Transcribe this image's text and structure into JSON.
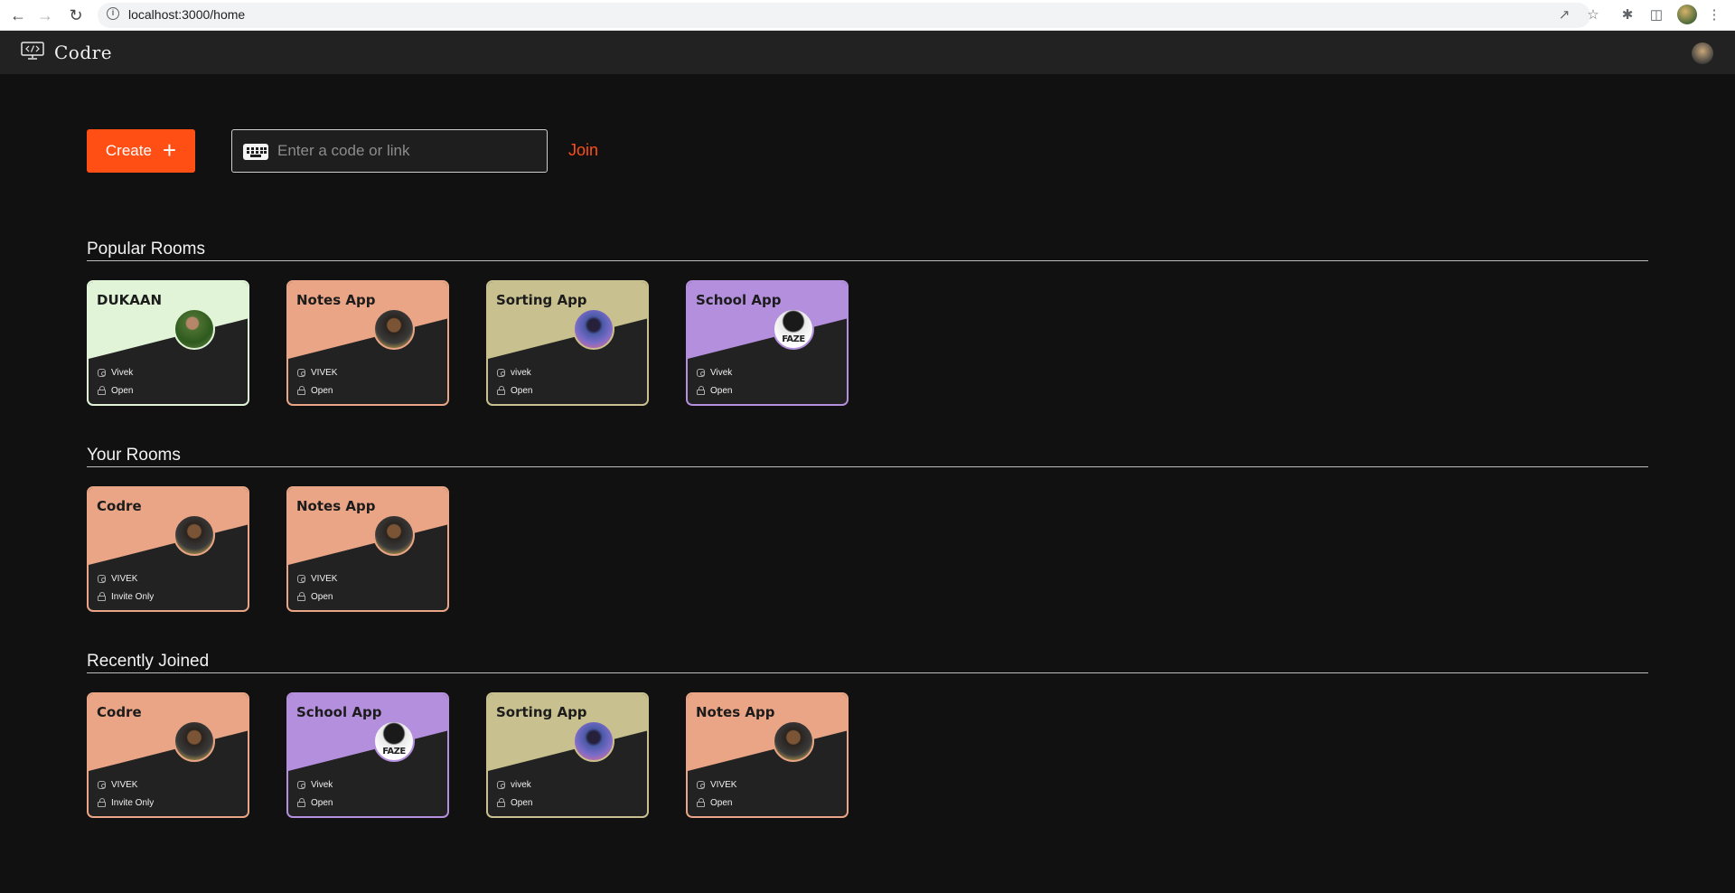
{
  "browser": {
    "url": "localhost:3000/home"
  },
  "header": {
    "brand": "Codre"
  },
  "actions": {
    "create_label": "Create",
    "code_placeholder": "Enter a code or link",
    "join_label": "Join"
  },
  "sections": [
    {
      "title": "Popular Rooms",
      "rooms": [
        {
          "name": "DUKAAN",
          "owner": "Vivek",
          "access": "Open",
          "color": "#e2f4d7",
          "avatar": "dukaan"
        },
        {
          "name": "Notes App",
          "owner": "VIVEK",
          "access": "Open",
          "color": "#e9a585",
          "avatar": "person"
        },
        {
          "name": "Sorting App",
          "owner": "vivek",
          "access": "Open",
          "color": "#c8c08e",
          "avatar": "blue"
        },
        {
          "name": "School App",
          "owner": "Vivek",
          "access": "Open",
          "color": "#b48fdd",
          "avatar": "faze"
        }
      ]
    },
    {
      "title": "Your Rooms",
      "rooms": [
        {
          "name": "Codre",
          "owner": "VIVEK",
          "access": "Invite Only",
          "color": "#e9a585",
          "avatar": "person"
        },
        {
          "name": "Notes App",
          "owner": "VIVEK",
          "access": "Open",
          "color": "#e9a585",
          "avatar": "person"
        }
      ]
    },
    {
      "title": "Recently Joined",
      "rooms": [
        {
          "name": "Codre",
          "owner": "VIVEK",
          "access": "Invite Only",
          "color": "#e9a585",
          "avatar": "person"
        },
        {
          "name": "School App",
          "owner": "Vivek",
          "access": "Open",
          "color": "#b48fdd",
          "avatar": "faze"
        },
        {
          "name": "Sorting App",
          "owner": "vivek",
          "access": "Open",
          "color": "#c8c08e",
          "avatar": "blue"
        },
        {
          "name": "Notes App",
          "owner": "VIVEK",
          "access": "Open",
          "color": "#e9a585",
          "avatar": "person"
        }
      ]
    }
  ],
  "avatar_labels": {
    "faze": "FAZE"
  }
}
